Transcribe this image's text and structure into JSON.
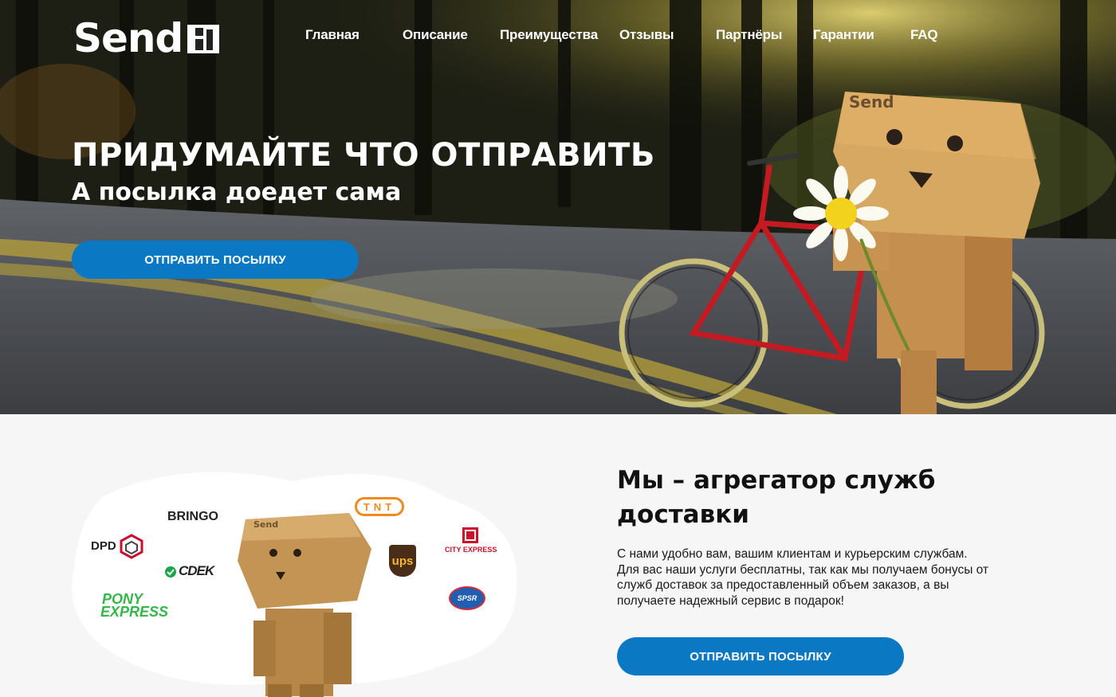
{
  "header": {
    "logo_text": "Send",
    "nav": [
      {
        "label": "Главная"
      },
      {
        "label": "Описание"
      },
      {
        "label": "Преимущества"
      },
      {
        "label": "Отзывы"
      },
      {
        "label": "Партнёры"
      },
      {
        "label": "Гарантии"
      },
      {
        "label": "FAQ"
      }
    ]
  },
  "hero": {
    "title": "ПРИДУМАЙТЕ ЧТО ОТПРАВИТЬ",
    "subtitle": "А посылка доедет сама",
    "button_label": "ОТПРАВИТЬ ПОСЫЛКУ",
    "box_label": "Send"
  },
  "about": {
    "title": "Мы – агрегатор служб доставки",
    "text": "С нами удобно вам, вашим клиентам и курьерским службам. Для вас наши услуги бесплатны, так как мы получаем бонусы от служб доставок за предоставленный объем заказов, а вы получаете надежный сервис в подарок!",
    "button_label": "ОТПРАВИТЬ ПОСЫЛКУ",
    "partners": {
      "bringo": "BRINGO",
      "dpd": "DPD",
      "cdek": "CDEK",
      "pony_1": "PONY",
      "pony_2": "EXPRESS",
      "tnt": "TNT",
      "ups": "ups",
      "city_express": "CITY EXPRESS",
      "spsr": "SPSR"
    }
  },
  "colors": {
    "accent": "#0a78c2",
    "hero_text": "#ffffff",
    "page_bg": "#f6f6f6"
  }
}
